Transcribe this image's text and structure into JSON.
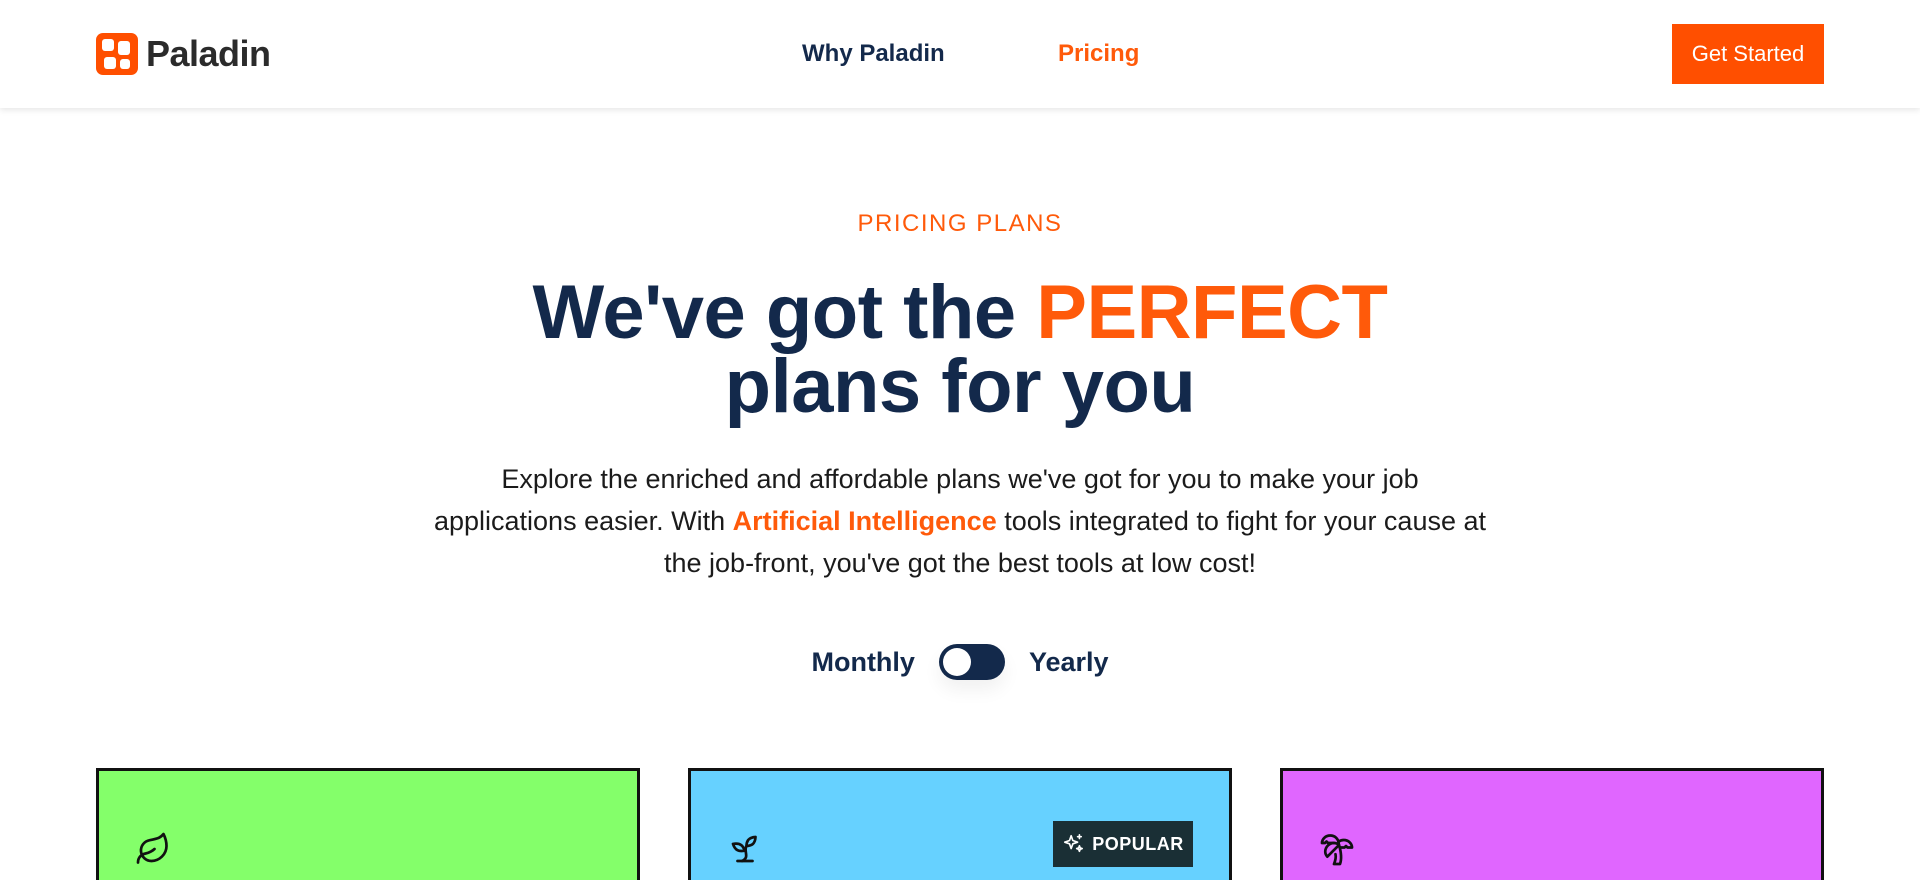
{
  "brand": {
    "name": "Paladin",
    "accent": "#ff5a0a",
    "navy": "#13294b"
  },
  "nav": {
    "why_label": "Why Paladin",
    "pricing_label": "Pricing",
    "cta_label": "Get Started"
  },
  "hero": {
    "eyebrow": "PRICING PLANS",
    "headline_part1": "We've got the ",
    "headline_accent": "PERFECT",
    "headline_part2": "plans for you",
    "subtext_part1": "Explore the enriched and affordable plans we've got for you to make your job applications easier. With ",
    "subtext_accent": "Artificial Intelligence",
    "subtext_part2": " tools integrated to fight for your cause at the job-front, you've got the best tools at low cost!"
  },
  "billing_toggle": {
    "monthly_label": "Monthly",
    "yearly_label": "Yearly",
    "selected": "Monthly"
  },
  "plans": [
    {
      "icon": "leaf-icon",
      "color": "#84ff6a"
    },
    {
      "icon": "sprout-icon",
      "color": "#66d1ff",
      "badge": "POPULAR",
      "badge_icon": "sparkles-icon"
    },
    {
      "icon": "palm-tree-icon",
      "color": "#e066ff"
    }
  ]
}
